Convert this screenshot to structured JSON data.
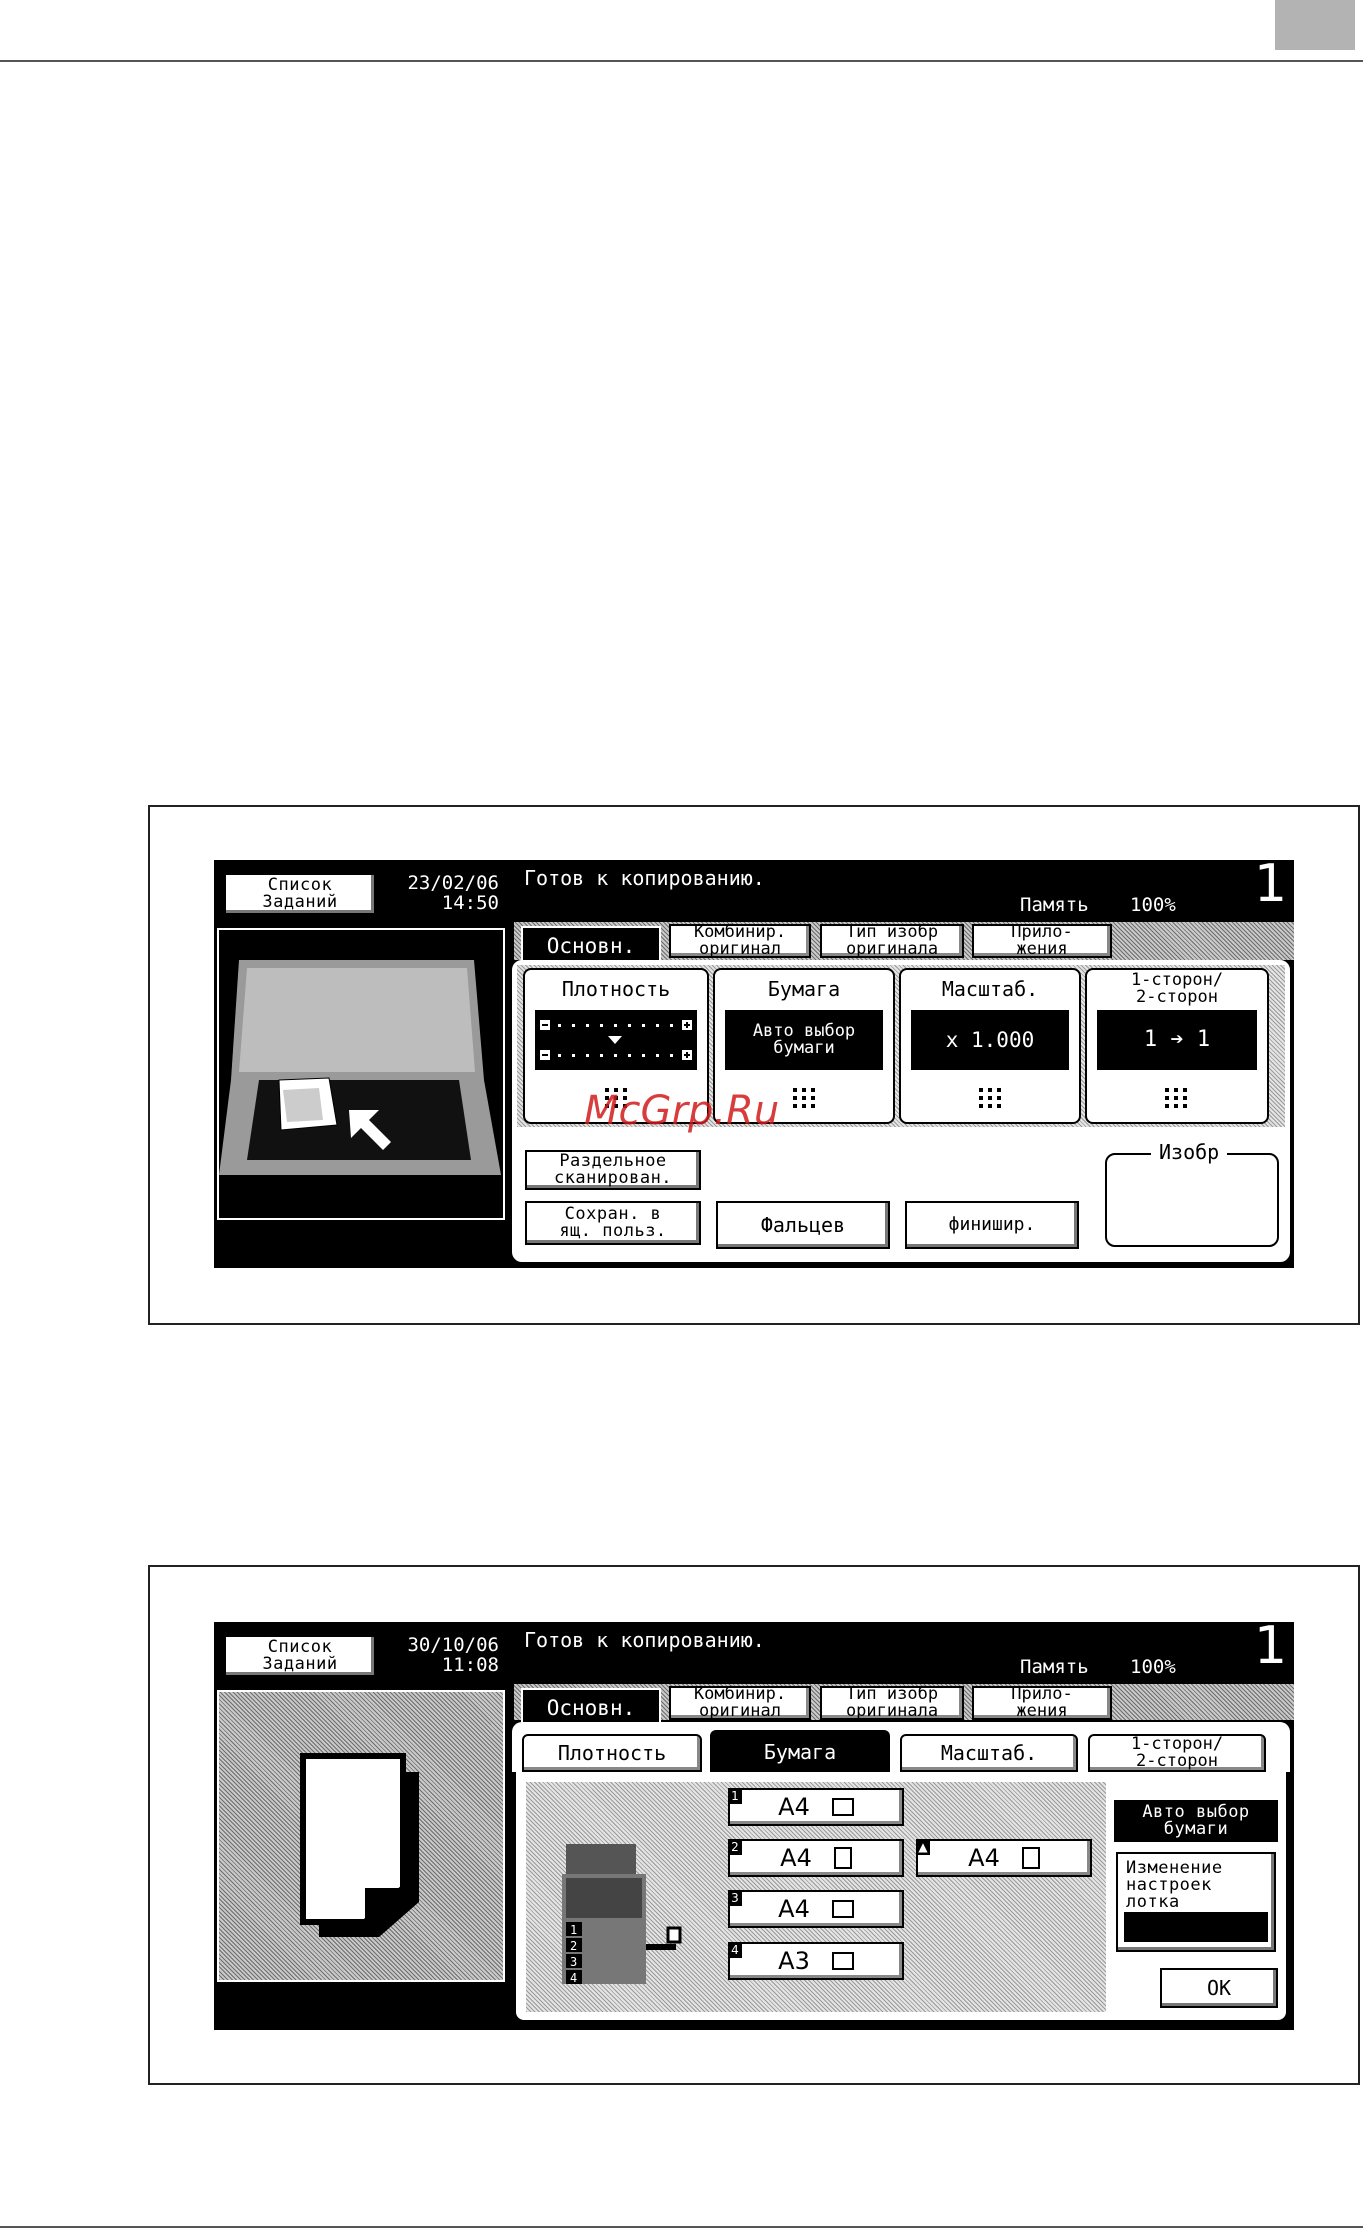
{
  "panel1": {
    "job_list_label": "Список\nЗаданий",
    "date": "23/02/06",
    "time": "14:50",
    "status": "Готов к копированию.",
    "memory_label": "Память",
    "memory_value": "100%",
    "copies": "1",
    "tabs": [
      "Основн.",
      "Комбинир.\nоригинал",
      "Тип изобр\nоригинала",
      "Прило-\nжения"
    ],
    "functions": [
      {
        "title": "Плотность",
        "value": ""
      },
      {
        "title": "Бумага",
        "value": "Авто выбор\nбумаги"
      },
      {
        "title": "Масштаб.",
        "value": "x 1.000"
      },
      {
        "title": "1-сторон/\n2-сторон",
        "value": "1 ➔ 1"
      }
    ],
    "separate_scan": "Раздельное\nсканирован.",
    "save_box": "Сохран. в\nящ. польз.",
    "fold": "Фальцев",
    "finish": "финишир.",
    "image_box": "Изобр",
    "watermark": "McGrp.Ru"
  },
  "panel2": {
    "job_list_label": "Список\nЗаданий",
    "date": "30/10/06",
    "time": "11:08",
    "status": "Готов к копированию.",
    "memory_label": "Память",
    "memory_value": "100%",
    "copies": "1",
    "tabs": [
      "Основн.",
      "Комбинир.\nоригинал",
      "Тип изобр\nоригинала",
      "Прило-\nжения"
    ],
    "subtabs": [
      "Плотность",
      "Бумага",
      "Масштаб.",
      "1-сторон/\n2-сторон"
    ],
    "trays": [
      {
        "num": "1",
        "size": "A4"
      },
      {
        "num": "2",
        "size": "A4"
      },
      {
        "num": "3",
        "size": "A4"
      },
      {
        "num": "4",
        "size": "A3"
      }
    ],
    "bypass": {
      "size": "A4"
    },
    "auto_paper": "Авто выбор\nбумаги",
    "tray_settings": "Изменение\nнастроек\nлотка",
    "ok": "OK",
    "machine_trays": [
      "1",
      "2",
      "3",
      "4"
    ]
  }
}
